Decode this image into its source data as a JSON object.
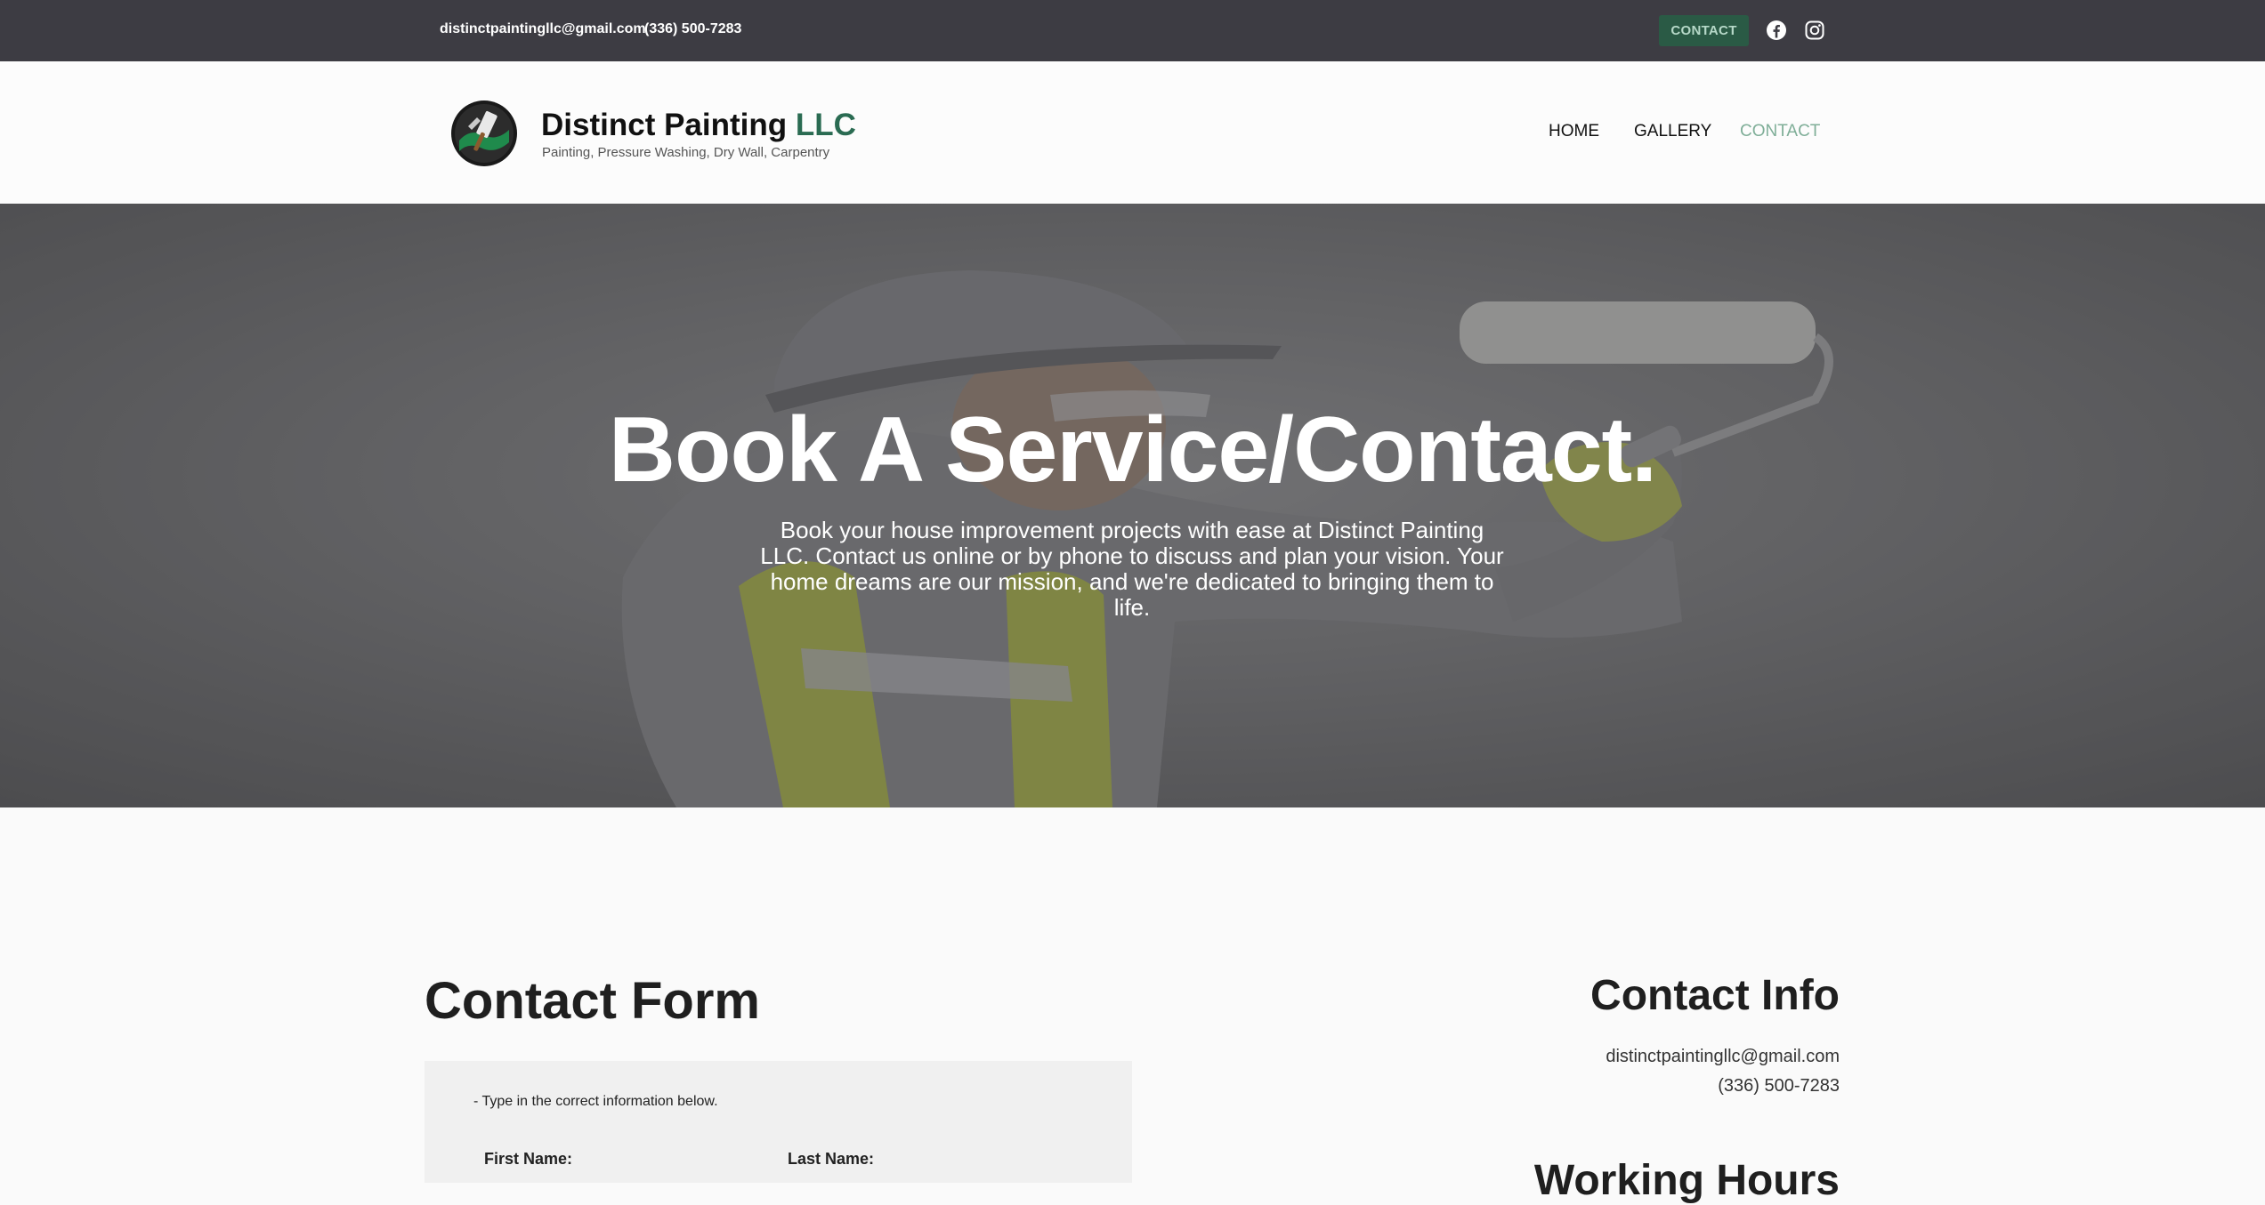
{
  "topbar": {
    "email": "distinctpaintingllc@gmail.com",
    "phone": "(336) 500-7283",
    "contact_button": "CONTACT",
    "social_icons": [
      "facebook-icon",
      "instagram-icon"
    ]
  },
  "header": {
    "brand_name": "Distinct Painting",
    "brand_suffix": "LLC",
    "tagline": "Painting, Pressure Washing, Dry Wall, Carpentry",
    "nav": {
      "home": "HOME",
      "gallery": "GALLERY",
      "contact": "CONTACT"
    },
    "active_nav": "contact"
  },
  "hero": {
    "title": "Book A Service/Contact.",
    "text": "Book your house improvement projects with ease at Distinct Painting LLC. Contact us online or by phone to discuss and plan your vision. Your home dreams are our mission, and we're dedicated to bringing them to life."
  },
  "contact_form": {
    "title": "Contact Form",
    "note": "- Type in the correct information below.",
    "first_name_label": "First Name:",
    "last_name_label": "Last Name:"
  },
  "contact_info": {
    "title": "Contact Info",
    "email": "distinctpaintingllc@gmail.com",
    "phone": "(336) 500-7283",
    "working_hours_title": "Working Hours"
  },
  "colors": {
    "topbar": "#3d3c43",
    "accent_green": "#2a6b52",
    "button_green": "#2a5a45",
    "nav_active": "#7fae98"
  }
}
